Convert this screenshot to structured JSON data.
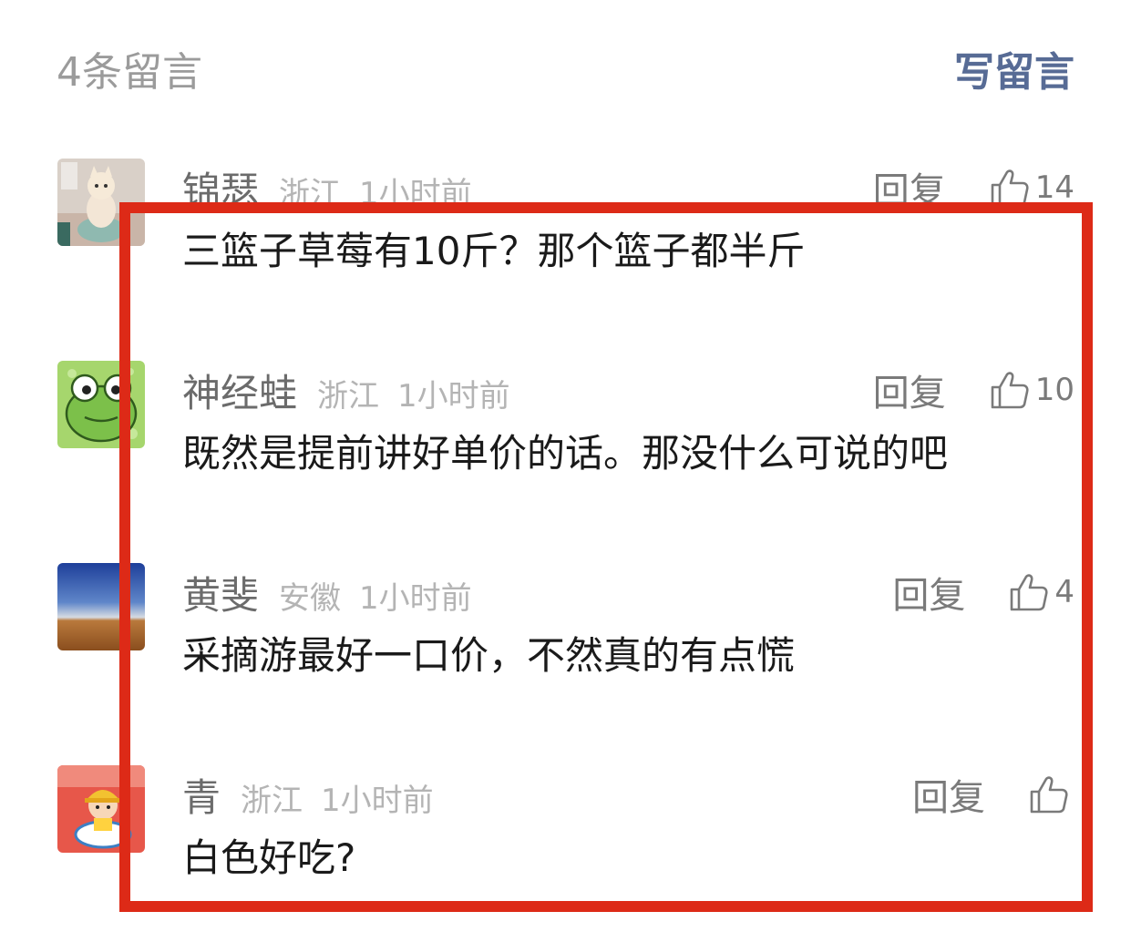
{
  "header": {
    "count_label": "4条留言",
    "write_label": "写留言"
  },
  "comments": [
    {
      "nickname": "锦瑟",
      "region": "浙江",
      "time": "1小时前",
      "reply_label": "回复",
      "likes": "14",
      "text": "三篮子草莓有10斤？那个篮子都半斤",
      "avatar": "cat-figurine-avatar"
    },
    {
      "nickname": "神经蛙",
      "region": "浙江",
      "time": "1小时前",
      "reply_label": "回复",
      "likes": "10",
      "text": "既然是提前讲好单价的话。那没什么可说的吧",
      "avatar": "frog-avatar"
    },
    {
      "nickname": "黄斐",
      "region": "安徽",
      "time": "1小时前",
      "reply_label": "回复",
      "likes": "4",
      "text": "采摘游最好一口价，不然真的有点慌",
      "avatar": "sky-desert-avatar"
    },
    {
      "nickname": "青",
      "region": "浙江",
      "time": "1小时前",
      "reply_label": "回复",
      "likes": "",
      "text": "白色好吃?",
      "avatar": "cartoon-kid-avatar"
    }
  ],
  "colors": {
    "link": "#576b95",
    "frame": "#dd2a17",
    "muted": "#9b9b9b"
  },
  "icons": {
    "like": "thumbs-up-icon"
  }
}
